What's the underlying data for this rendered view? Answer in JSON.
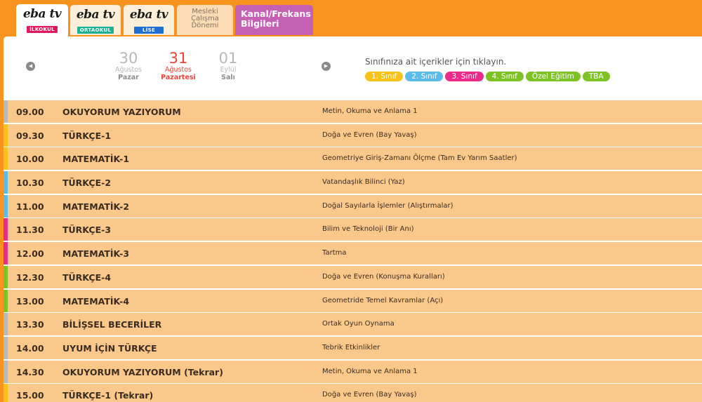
{
  "tabs": [
    {
      "word": "eba tv",
      "tag": "İLKOKUL",
      "tag_color": "#e4195d",
      "active": true
    },
    {
      "word": "eba tv",
      "tag": "ORTAOKUL",
      "tag_color": "#1bb190",
      "active": false
    },
    {
      "word": "eba tv",
      "tag": "LİSE",
      "tag_color": "#1e6fd1",
      "active": false
    }
  ],
  "mesleki_tab": [
    "Mesleki",
    "Çalışma",
    "Dönemi"
  ],
  "kanal_tab": [
    "Kanal/Frekans",
    "Bilgileri"
  ],
  "days": [
    {
      "num": "30",
      "month": "Ağustos",
      "name": "Pazar",
      "active": false
    },
    {
      "num": "31",
      "month": "Ağustos",
      "name": "Pazartesi",
      "active": true
    },
    {
      "num": "01",
      "month": "Eylül",
      "name": "Salı",
      "active": false
    }
  ],
  "hint": "Sınıfınıza ait içerikler için tıklayın.",
  "grades": [
    {
      "label": "1. Sınıf",
      "color": "#f7c21a"
    },
    {
      "label": "2. Sınıf",
      "color": "#5bbcea"
    },
    {
      "label": "3. Sınıf",
      "color": "#ec2a8a"
    },
    {
      "label": "4. Sınıf",
      "color": "#7ec226"
    },
    {
      "label": "Özel Eğitim",
      "color": "#7ec226"
    },
    {
      "label": "TBA",
      "color": "#7ec226"
    }
  ],
  "schedule": [
    {
      "time": "09.00",
      "course": "OKUYORUM YAZIYORUM",
      "topic": "Metin, Okuma ve Anlama 1",
      "bar": "#b9b9b9"
    },
    {
      "time": "09.30",
      "course": "TÜRKÇE-1",
      "topic": "Doğa ve Evren (Bay Yavaş)",
      "bar": "#f7c21a"
    },
    {
      "time": "10.00",
      "course": "MATEMATİK-1",
      "topic": "Geometriye Giriş-Zamanı Ölçme (Tam Ev Yarım Saatler)",
      "bar": "#f7c21a"
    },
    {
      "time": "10.30",
      "course": "TÜRKÇE-2",
      "topic": "Vatandaşlık Bilinci (Yaz)",
      "bar": "#5bbcea"
    },
    {
      "time": "11.00",
      "course": "MATEMATİK-2",
      "topic": "Doğal Sayılarla İşlemler (Alıştırmalar)",
      "bar": "#5bbcea"
    },
    {
      "time": "11.30",
      "course": "TÜRKÇE-3",
      "topic": "Bilim ve Teknoloji (Bir Anı)",
      "bar": "#ec2a8a"
    },
    {
      "time": "12.00",
      "course": "MATEMATİK-3",
      "topic": "Tartma",
      "bar": "#ec2a8a"
    },
    {
      "time": "12.30",
      "course": "TÜRKÇE-4",
      "topic": "Doğa ve Evren (Konuşma Kuralları)",
      "bar": "#7ec226"
    },
    {
      "time": "13.00",
      "course": "MATEMATİK-4",
      "topic": "Geometride Temel Kavramlar (Açı)",
      "bar": "#7ec226"
    },
    {
      "time": "13.30",
      "course": "BİLİŞSEL BECERİLER",
      "topic": "Ortak Oyun Oynama",
      "bar": "#b9b9b9"
    },
    {
      "time": "14.00",
      "course": "UYUM İÇİN TÜRKÇE",
      "topic": "Tebrik Etkinlikler",
      "bar": "#b9b9b9"
    },
    {
      "time": "14.30",
      "course": "OKUYORUM YAZIYORUM (Tekrar)",
      "topic": "Metin, Okuma ve Anlama 1",
      "bar": "#b9b9b9"
    },
    {
      "time": "15.00",
      "course": "TÜRKÇE-1 (Tekrar)",
      "topic": "Doğa ve Evren (Bay Yavaş)",
      "bar": "#f7c21a"
    }
  ]
}
